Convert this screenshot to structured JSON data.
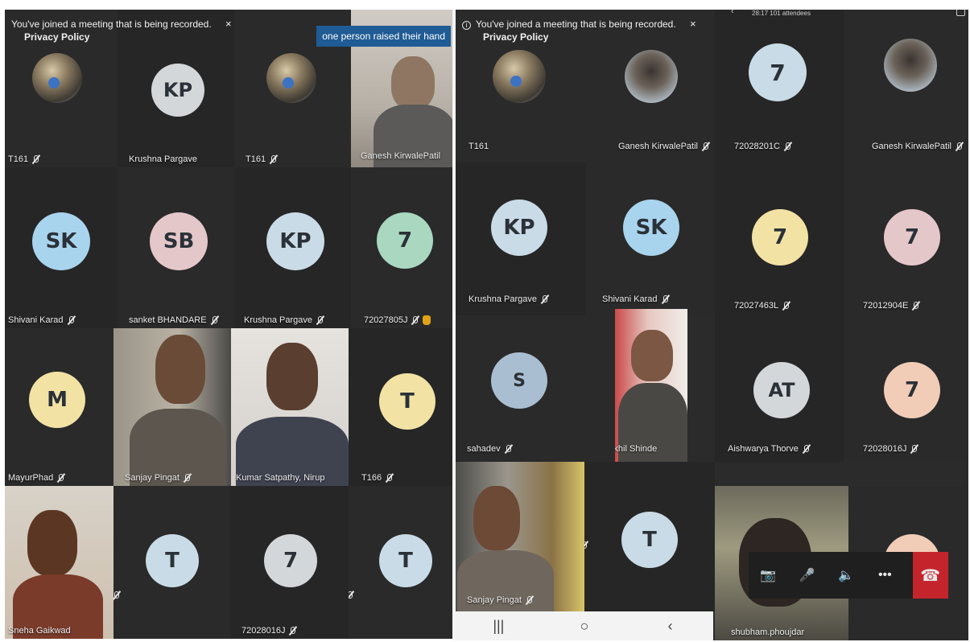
{
  "left": {
    "banner": {
      "message": "You've joined a meeting that is being recorded.",
      "policy": "Privacy Policy",
      "close": "×"
    },
    "raise_toast": "one person raised their hand",
    "tiles": [
      {
        "name": "T161"
      },
      {
        "name": "Krushna Pargave",
        "initials": "KP"
      },
      {
        "name": "T161"
      },
      {
        "name": "Ganesh KirwalePatil"
      },
      {
        "name": "Shivani Karad",
        "initials": "SK"
      },
      {
        "name": "sanket BHANDARE",
        "initials": "SB"
      },
      {
        "name": "Krushna Pargave",
        "initials": "KP"
      },
      {
        "name": "72027805J",
        "initials": "7"
      },
      {
        "name": "MayurPhad",
        "initials": "M"
      },
      {
        "name": "Sanjay Pingat"
      },
      {
        "name": "Kumar Satpathy, Nirup"
      },
      {
        "name": "T166",
        "initials": "T"
      },
      {
        "name": "Sneha Gaikwad"
      },
      {
        "initials": "T"
      },
      {
        "name": "72028016J",
        "initials": "7"
      },
      {
        "initials": "T"
      }
    ]
  },
  "right": {
    "banner": {
      "message": "You've joined a meeting that is being recorded.",
      "policy": "Privacy Policy",
      "close": "×",
      "info": "i"
    },
    "meeting_meta": "28:17  101 attendees",
    "tiles": [
      {
        "name": "T161"
      },
      {
        "name": "Ganesh KirwalePatil"
      },
      {
        "name": "72028201C",
        "initials": "7"
      },
      {
        "name": "Ganesh KirwalePatil"
      },
      {
        "name": "Krushna Pargave",
        "initials": "KP"
      },
      {
        "name": "Shivani Karad",
        "initials": "SK"
      },
      {
        "name": "72027463L",
        "initials": "7"
      },
      {
        "name": "72012904E",
        "initials": "7"
      },
      {
        "name": "sahadev",
        "initials": "S"
      },
      {
        "name": "Nikhil Shinde"
      },
      {
        "name": "Aishwarya Thorve",
        "initials": "AT"
      },
      {
        "name": "72028016J",
        "initials": "7"
      },
      {
        "name": "Sanjay Pingat"
      },
      {
        "initials": "T"
      },
      {
        "name": "shubham.phoujdar"
      }
    ],
    "controls": {
      "camera_off": "📷",
      "mic_off": "🎤",
      "speaker": "🔈",
      "more": "•••",
      "hangup": "☎"
    },
    "nav": {
      "recents": "|||",
      "home": "○",
      "back": "‹"
    }
  },
  "colors": {
    "blue_avatar": "#a9d4ee",
    "light_blue": "#c9dbe6",
    "pink": "#e4c7c9",
    "green": "#a9d7bf",
    "yellow": "#f2e3a5",
    "peach": "#f1ccb7",
    "grey": "#d4d7da",
    "hangup_red": "#c4252c",
    "toast_blue": "#1f5b94"
  }
}
